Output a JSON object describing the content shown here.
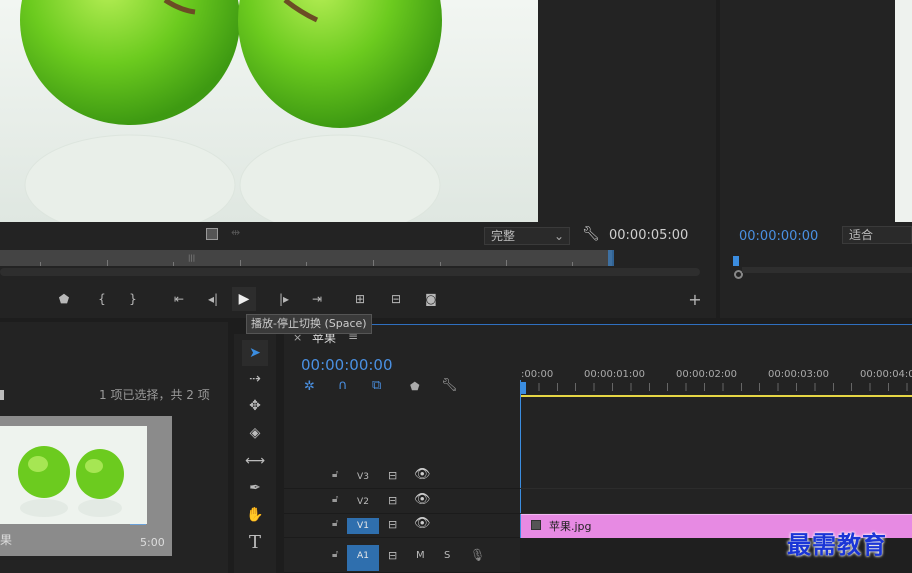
{
  "program_monitor": {
    "quality_dropdown": "完整",
    "timecode_end": "00:00:05:00"
  },
  "right_monitor": {
    "timecode": "00:00:00:00",
    "fit_dropdown": "适合"
  },
  "tooltip": {
    "text": "播放-停止切换 (Space)"
  },
  "project_panel": {
    "selection_info": "1 项已选择，共 2 项",
    "clip_name": "果",
    "clip_duration": "5:00"
  },
  "timeline": {
    "sequence_tab": "苹果",
    "timecode": "00:00:00:00",
    "ruler": [
      ":00:00",
      "00:00:01:00",
      "00:00:02:00",
      "00:00:03:00",
      "00:00:04:0"
    ],
    "tracks": [
      {
        "name": "V3",
        "targeted": false
      },
      {
        "name": "V2",
        "targeted": false
      },
      {
        "name": "V1",
        "targeted": true
      },
      {
        "name": "A1",
        "targeted": true
      }
    ],
    "audio_m": "M",
    "audio_s": "S",
    "clip_label": "苹果.jpg",
    "clip_color": "#e78ae3"
  },
  "watermark": "最需教育",
  "colors": {
    "accent": "#3b8de0",
    "timecode_blue": "#4a90e2",
    "track_target": "#2f6fae"
  }
}
